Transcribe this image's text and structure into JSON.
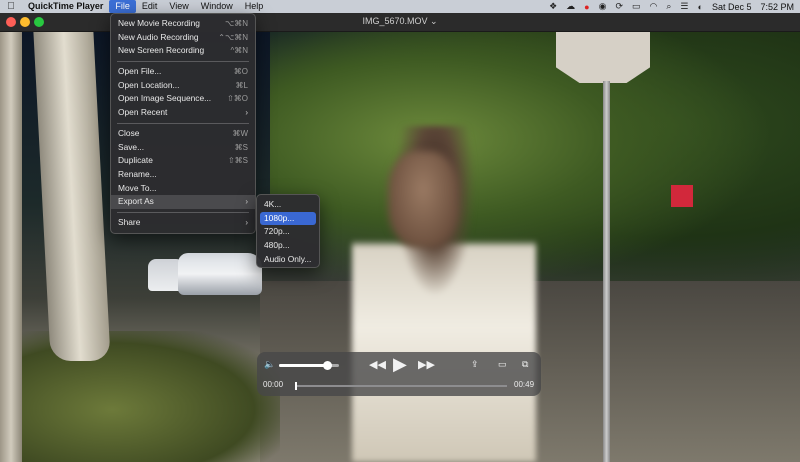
{
  "menubar": {
    "app_name": "QuickTime Player",
    "items": [
      "File",
      "Edit",
      "View",
      "Window",
      "Help"
    ],
    "active_item": "File",
    "status": {
      "date": "Sat Dec 5",
      "time": "7:52 PM"
    }
  },
  "window": {
    "title": "IMG_5670.MOV ⌄"
  },
  "file_menu": {
    "items": [
      {
        "label": "New Movie Recording",
        "shortcut": "⌥⌘N"
      },
      {
        "label": "New Audio Recording",
        "shortcut": "⌃⌥⌘N"
      },
      {
        "label": "New Screen Recording",
        "shortcut": "^⌘N"
      },
      {
        "label": "Open File...",
        "shortcut": "⌘O"
      },
      {
        "label": "Open Location...",
        "shortcut": "⌘L"
      },
      {
        "label": "Open Image Sequence...",
        "shortcut": "⇧⌘O"
      },
      {
        "label": "Open Recent",
        "shortcut": ""
      },
      {
        "label": "Close",
        "shortcut": "⌘W"
      },
      {
        "label": "Save...",
        "shortcut": "⌘S"
      },
      {
        "label": "Duplicate",
        "shortcut": "⇧⌘S"
      },
      {
        "label": "Rename...",
        "shortcut": ""
      },
      {
        "label": "Move To...",
        "shortcut": ""
      },
      {
        "label": "Export As",
        "shortcut": ""
      },
      {
        "label": "Share",
        "shortcut": ""
      }
    ]
  },
  "export_submenu": {
    "items": [
      "4K...",
      "1080p...",
      "720p...",
      "480p...",
      "Audio Only..."
    ],
    "highlighted": "1080p..."
  },
  "player": {
    "current_time": "00:00",
    "end_time": "00:49",
    "volume_fraction": 0.8,
    "progress_fraction": 0.0,
    "icons": [
      "volume-icon",
      "rewind-icon",
      "play-icon",
      "fast-forward-icon",
      "share-icon",
      "airplay-icon",
      "picture-in-picture-icon"
    ]
  }
}
